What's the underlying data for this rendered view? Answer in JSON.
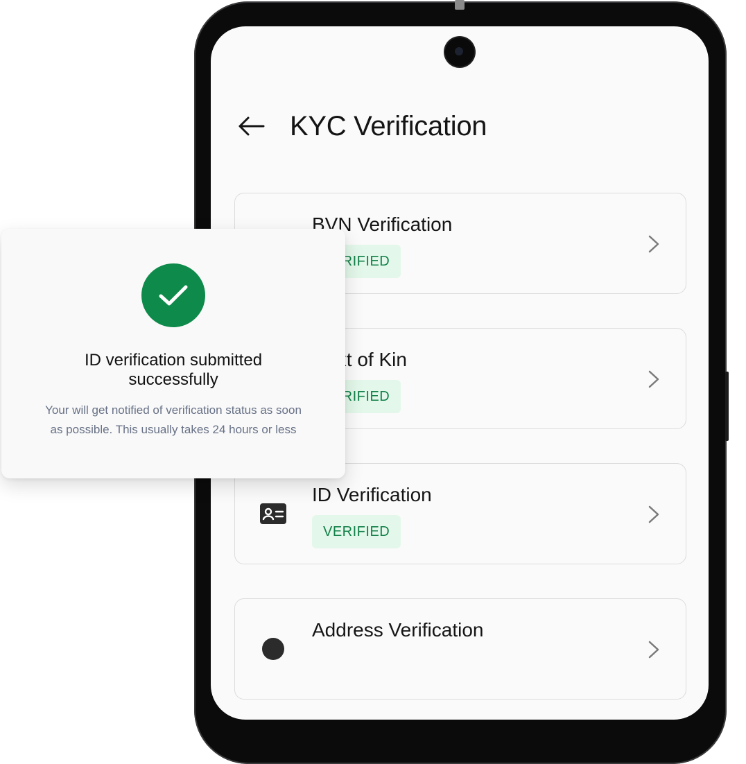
{
  "header": {
    "title": "KYC Verification",
    "back_icon": "arrow-left-icon"
  },
  "cards": [
    {
      "title": "BVN Verification",
      "status": "VERIFIED",
      "icon": "bvn-icon"
    },
    {
      "title": "Next of Kin",
      "status": "VERIFIED",
      "icon": "person-icon"
    },
    {
      "title": "ID Verification",
      "status": "VERIFIED",
      "icon": "id-card-icon"
    },
    {
      "title": "Address Verification",
      "status": "",
      "icon": "location-pin-icon"
    }
  ],
  "modal": {
    "icon": "check-circle-icon",
    "title_line1": "ID verification submitted",
    "title_line2": "successfully",
    "message_line1": "Your will get notified of verification status as soon",
    "message_line2": "as possible. This usually takes 24 hours or less"
  },
  "colors": {
    "success_green": "#0e8a4a",
    "badge_bg": "#e3f8ea",
    "badge_text": "#138049",
    "phone_frame": "#0b0b0c",
    "screen_bg": "#fafafa"
  }
}
